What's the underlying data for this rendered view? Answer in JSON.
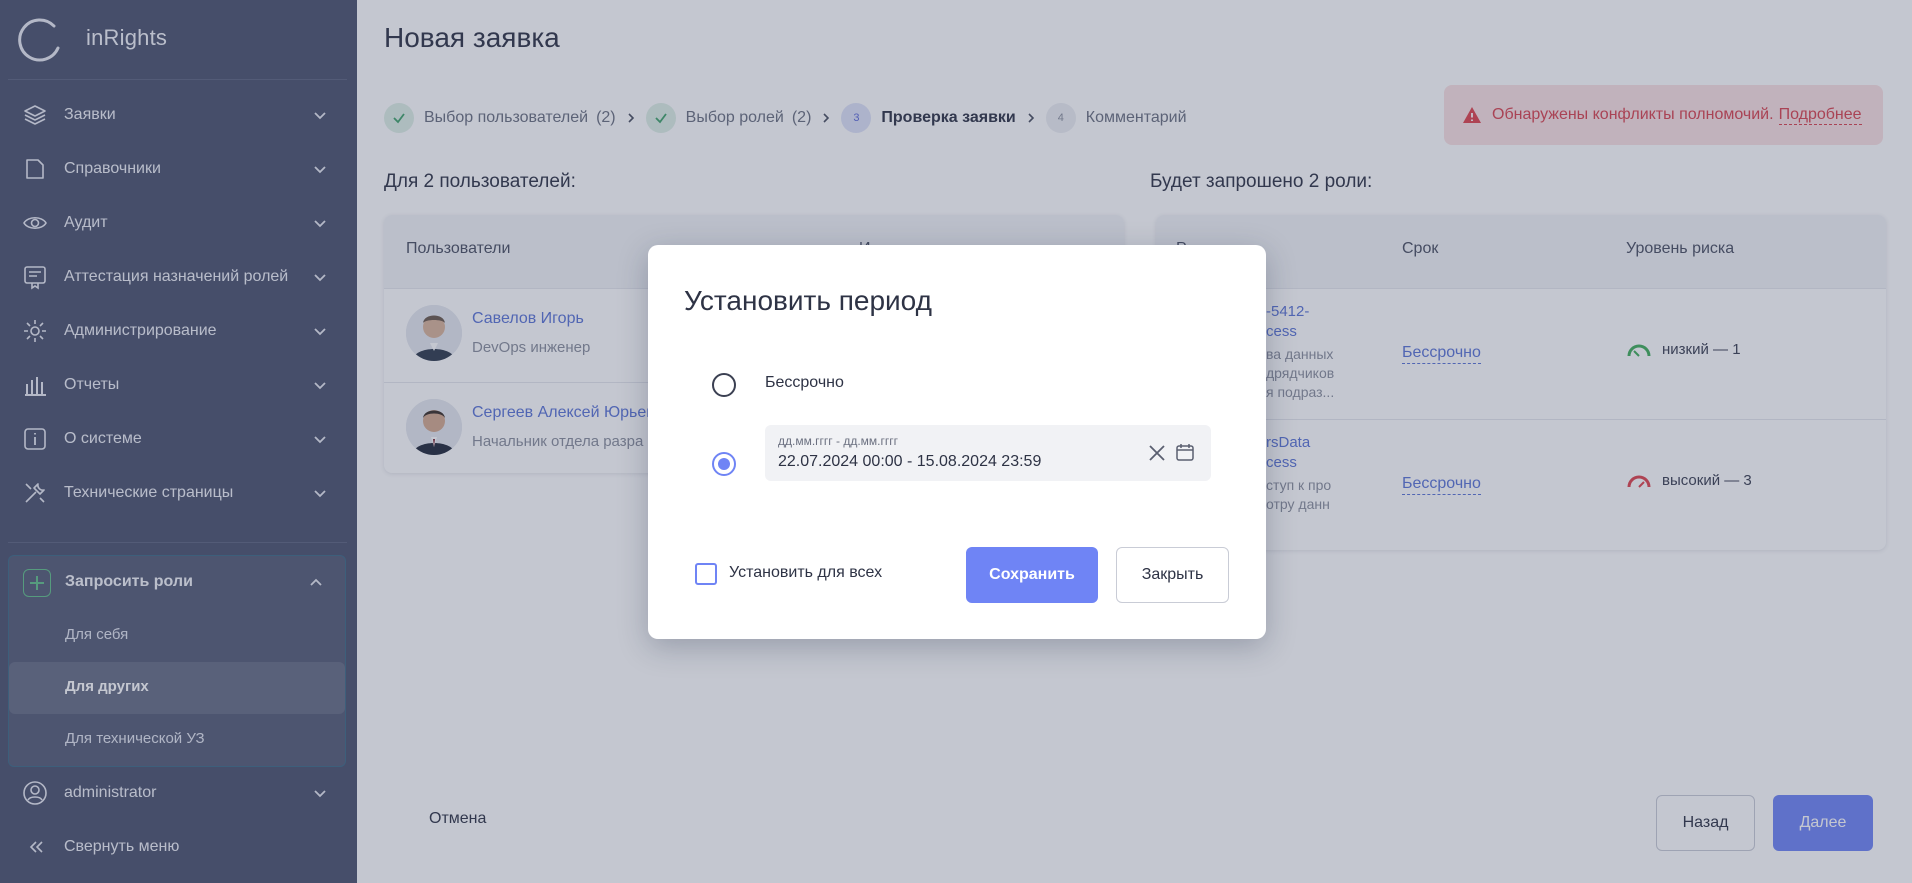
{
  "app": {
    "brand": "inRights"
  },
  "sidebar": {
    "items": [
      {
        "label": "Заявки",
        "icon": "layers-icon"
      },
      {
        "label": "Справочники",
        "icon": "folder-icon"
      },
      {
        "label": "Аудит",
        "icon": "eye-icon"
      },
      {
        "label": "Аттестация назначений ролей",
        "icon": "certificate-icon"
      },
      {
        "label": "Администрирование",
        "icon": "gear-icon"
      },
      {
        "label": "Отчеты",
        "icon": "bar-chart-icon"
      },
      {
        "label": "О системе",
        "icon": "info-icon"
      },
      {
        "label": "Технические страницы",
        "icon": "tools-icon"
      }
    ],
    "request_roles": {
      "label": "Запросить роли",
      "sub_items": [
        "Для себя",
        "Для других",
        "Для технической УЗ"
      ],
      "active": "Для других"
    },
    "user": "administrator",
    "collapse": "Свернуть меню"
  },
  "main": {
    "title": "Новая заявка",
    "steps": [
      {
        "label": "Выбор пользователей",
        "count": "(2)",
        "state": "done"
      },
      {
        "label": "Выбор ролей",
        "count": "(2)",
        "state": "done"
      },
      {
        "number": "3",
        "label": "Проверка заявки",
        "state": "current"
      },
      {
        "number": "4",
        "label": "Комментарий",
        "state": "todo"
      }
    ],
    "alert": {
      "text": "Обнаружены конфликты полномочий.",
      "link": "Подробнее"
    },
    "users_section_title": "Для 2 пользователей:",
    "users_table": {
      "header": "Пользователи",
      "header2_partial": "И",
      "rows": [
        {
          "name": "Савелов Игорь",
          "position": "DevOps инженер"
        },
        {
          "name": "Сергеев Алексей Юрьев",
          "position": "Начальник отдела разра"
        }
      ]
    },
    "roles_section_title": "Будет запрошено 2 роли:",
    "roles_table": {
      "headers": {
        "role_partial": "Р",
        "term": "Срок",
        "risk": "Уровень риска"
      },
      "rows": [
        {
          "name_lines": [
            "-5412-",
            "cess"
          ],
          "desc_lines": [
            "ва данных",
            "дрядчиков",
            "я подраз..."
          ],
          "term": "Бессрочно",
          "risk": "низкий — 1",
          "risk_color": "#3fae5a"
        },
        {
          "name_lines": [
            "rsData",
            "cess"
          ],
          "desc_lines": [
            "ступ к про",
            "отру данн"
          ],
          "term": "Бессрочно",
          "risk": "высокий — 3",
          "risk_color": "#e0424c"
        }
      ]
    },
    "cancel": "Отмена",
    "back": "Назад",
    "next": "Далее"
  },
  "modal": {
    "title": "Установить период",
    "option_indefinite": "Бессрочно",
    "period_placeholder": "дд.мм.гггг - дд.мм.гггг",
    "period_value": "22.07.2024 00:00 - 15.08.2024 23:59",
    "selected_option": "period",
    "set_for_all": "Установить для всех",
    "set_for_all_checked": false,
    "save": "Сохранить",
    "close": "Закрыть"
  },
  "colors": {
    "accent": "#6f84f5",
    "sidebar": "#4b526d",
    "danger": "#d9434f",
    "success": "#3fae5a"
  }
}
